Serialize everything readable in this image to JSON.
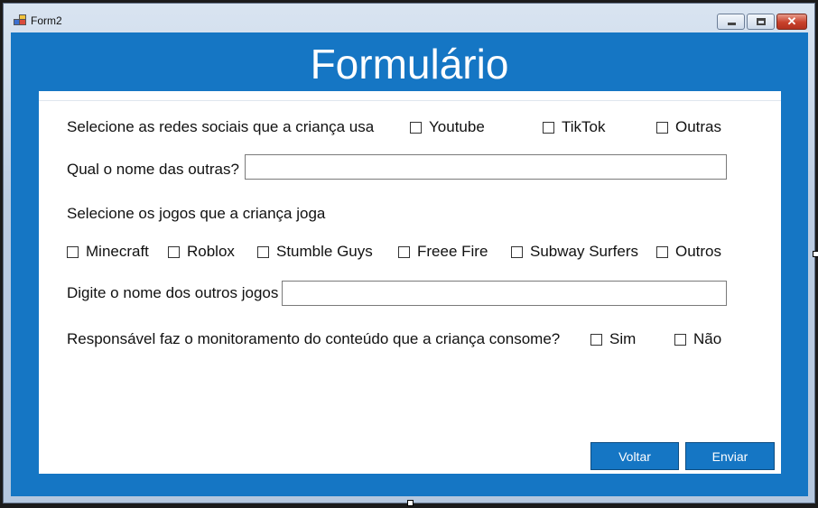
{
  "window": {
    "title": "Form2"
  },
  "header": {
    "title": "Formulário"
  },
  "social": {
    "label": "Selecione as redes sociais que a criança usa",
    "options": [
      "Youtube",
      "TikTok",
      "Outras"
    ]
  },
  "other_social": {
    "label": "Qual o nome das outras?",
    "value": ""
  },
  "games": {
    "label": "Selecione os jogos que a criança joga",
    "options": [
      "Minecraft",
      "Roblox",
      "Stumble Guys",
      "Freee Fire",
      "Subway Surfers",
      "Outros"
    ]
  },
  "other_games": {
    "label": "Digite o nome dos outros jogos",
    "value": ""
  },
  "monitoring": {
    "label": "Responsável faz o monitoramento do conteúdo que a criança consome?",
    "options": [
      "Sim",
      "Não"
    ]
  },
  "buttons": {
    "back": "Voltar",
    "send": "Enviar"
  },
  "colors": {
    "accent": "#1576c4",
    "panel": "#ffffff"
  },
  "icons": {
    "window": "app-icon",
    "minimize": "minimize-icon",
    "maximize": "maximize-icon",
    "close": "close-icon",
    "checkbox": "checkbox-icon"
  }
}
